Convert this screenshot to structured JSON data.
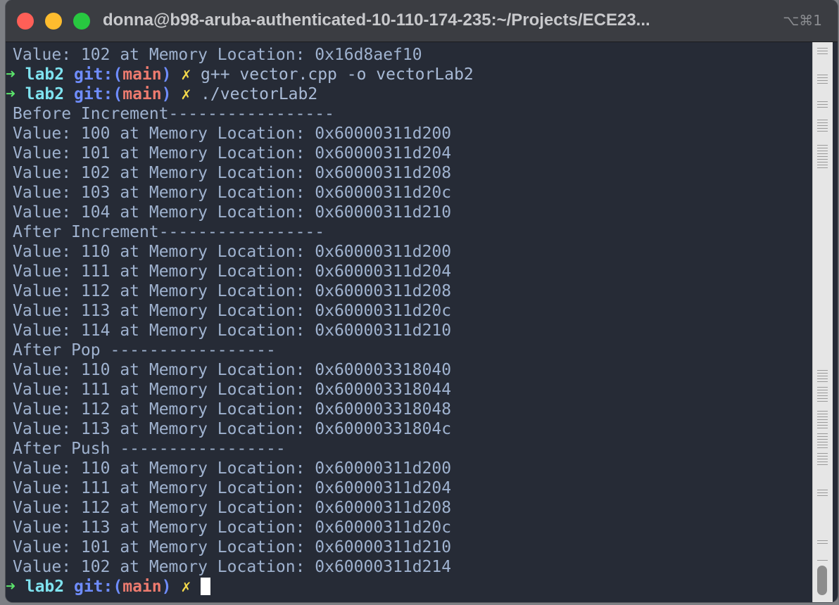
{
  "window": {
    "title": "donna@b98-aruba-authenticated-10-110-174-235:~/Projects/ECE23...",
    "shortcut": "⌥⌘1"
  },
  "prompt": {
    "arrow": "➜",
    "dir": "lab2",
    "git_label": "git:(",
    "branch": "main",
    "git_close": ")",
    "dirty": "✗"
  },
  "lines": [
    {
      "type": "output",
      "text": "Value: 102 at Memory Location: 0x16d8aef10"
    },
    {
      "type": "prompt",
      "cmd": "g++ vector.cpp -o vectorLab2"
    },
    {
      "type": "prompt",
      "cmd": "./vectorLab2"
    },
    {
      "type": "output",
      "text": "Before Increment-----------------"
    },
    {
      "type": "output",
      "text": "Value: 100 at Memory Location: 0x60000311d200"
    },
    {
      "type": "output",
      "text": "Value: 101 at Memory Location: 0x60000311d204"
    },
    {
      "type": "output",
      "text": "Value: 102 at Memory Location: 0x60000311d208"
    },
    {
      "type": "output",
      "text": "Value: 103 at Memory Location: 0x60000311d20c"
    },
    {
      "type": "output",
      "text": "Value: 104 at Memory Location: 0x60000311d210"
    },
    {
      "type": "output",
      "text": "After Increment-----------------"
    },
    {
      "type": "output",
      "text": "Value: 110 at Memory Location: 0x60000311d200"
    },
    {
      "type": "output",
      "text": "Value: 111 at Memory Location: 0x60000311d204"
    },
    {
      "type": "output",
      "text": "Value: 112 at Memory Location: 0x60000311d208"
    },
    {
      "type": "output",
      "text": "Value: 113 at Memory Location: 0x60000311d20c"
    },
    {
      "type": "output",
      "text": "Value: 114 at Memory Location: 0x60000311d210"
    },
    {
      "type": "output",
      "text": "After Pop -----------------"
    },
    {
      "type": "output",
      "text": "Value: 110 at Memory Location: 0x600003318040"
    },
    {
      "type": "output",
      "text": "Value: 111 at Memory Location: 0x600003318044"
    },
    {
      "type": "output",
      "text": "Value: 112 at Memory Location: 0x600003318048"
    },
    {
      "type": "output",
      "text": "Value: 113 at Memory Location: 0x60000331804c"
    },
    {
      "type": "output",
      "text": "After Push -----------------"
    },
    {
      "type": "output",
      "text": "Value: 110 at Memory Location: 0x60000311d200"
    },
    {
      "type": "output",
      "text": "Value: 111 at Memory Location: 0x60000311d204"
    },
    {
      "type": "output",
      "text": "Value: 112 at Memory Location: 0x60000311d208"
    },
    {
      "type": "output",
      "text": "Value: 113 at Memory Location: 0x60000311d20c"
    },
    {
      "type": "output",
      "text": "Value: 101 at Memory Location: 0x60000311d210"
    },
    {
      "type": "output",
      "text": "Value: 102 at Memory Location: 0x60000311d214"
    },
    {
      "type": "prompt",
      "cmd": "",
      "cursor": true
    }
  ],
  "colors": {
    "background": "#262b36",
    "output_text": "#9fb2cf",
    "prompt_arrow": "#5be36b",
    "prompt_dir": "#7fe3f0",
    "git_label": "#6f8dff",
    "branch": "#ee7b6f",
    "dirty_marker": "#f4d94a"
  }
}
